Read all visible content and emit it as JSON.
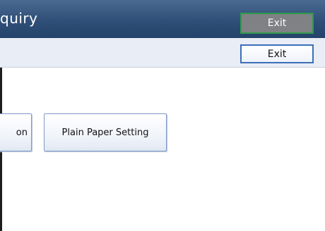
{
  "title_bar": {
    "title": "quiry",
    "exit_label": "Exit"
  },
  "toolbar": {
    "exit_label": "Exit"
  },
  "options": {
    "cut_off_label": "on",
    "plain_paper_label": "Plain Paper Setting"
  },
  "colors": {
    "title_bar": "#2f4f78",
    "active_border": "#2e9a4a",
    "button_border": "#3c6fb8"
  }
}
